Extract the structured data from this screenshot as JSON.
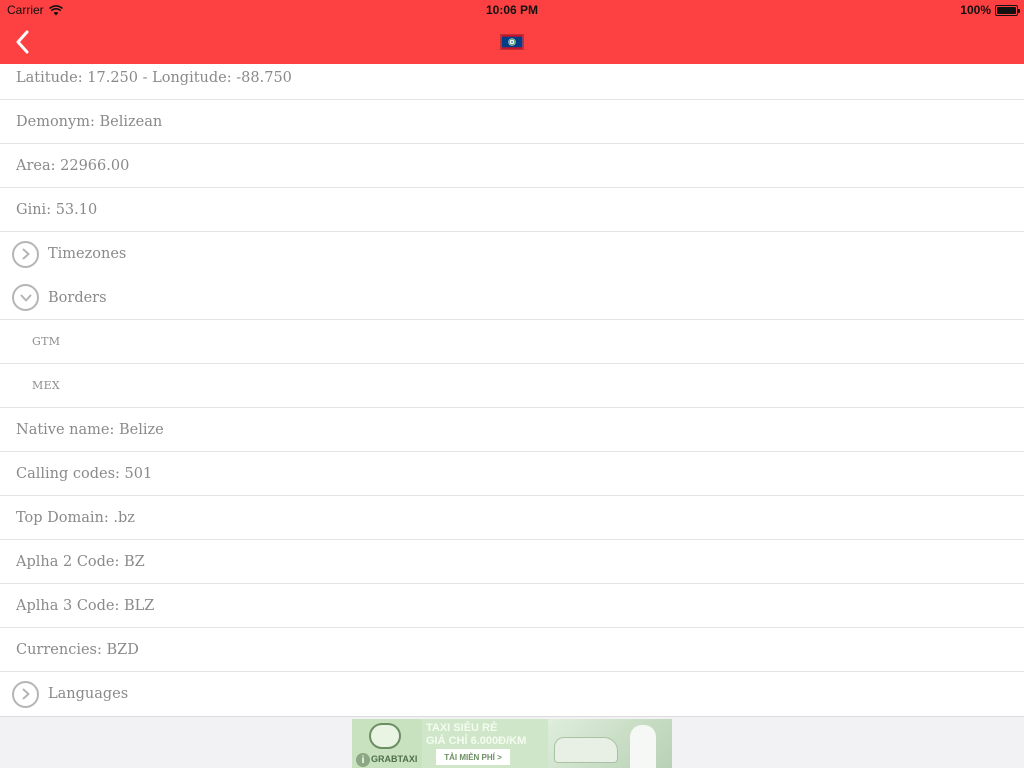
{
  "status_bar": {
    "carrier": "Carrier",
    "time": "10:06 PM",
    "battery": "100%",
    "battery_level": 1.0
  },
  "nav": {
    "back_icon": "chevron-left-icon",
    "flag_icon": "belize-flag-icon",
    "colors": {
      "background": "#fd4142",
      "tint": "#ffffff"
    }
  },
  "details": {
    "coordinates": "Latitude: 17.250 - Longitude: -88.750",
    "demonym": "Demonym: Belizean",
    "area": "Area: 22966.00",
    "gini": "Gini: 53.10",
    "timezones": {
      "label": "Timezones",
      "icon": "chevron-right-circle-icon",
      "expanded": false
    },
    "borders": {
      "label": "Borders",
      "icon": "chevron-down-circle-icon",
      "expanded": true,
      "items": [
        "GTM",
        "MEX"
      ]
    },
    "native_name": "Native name: Belize",
    "calling_codes": "Calling codes: 501",
    "top_domain": "Top Domain: .bz",
    "alpha2": "Aplha 2 Code: BZ",
    "alpha3": "Aplha 3 Code: BLZ",
    "currencies": "Currencies: BZD",
    "languages": {
      "label": "Languages",
      "icon": "chevron-right-circle-icon",
      "expanded": false
    }
  },
  "ad": {
    "line1": "TAXI SIÊU RẺ",
    "line2": "GIÁ CHỈ 6.000Đ/KM",
    "cta": "TẢI MIỄN PHÍ >",
    "brand": "GRABTAXI",
    "info_icon": "info-icon"
  }
}
